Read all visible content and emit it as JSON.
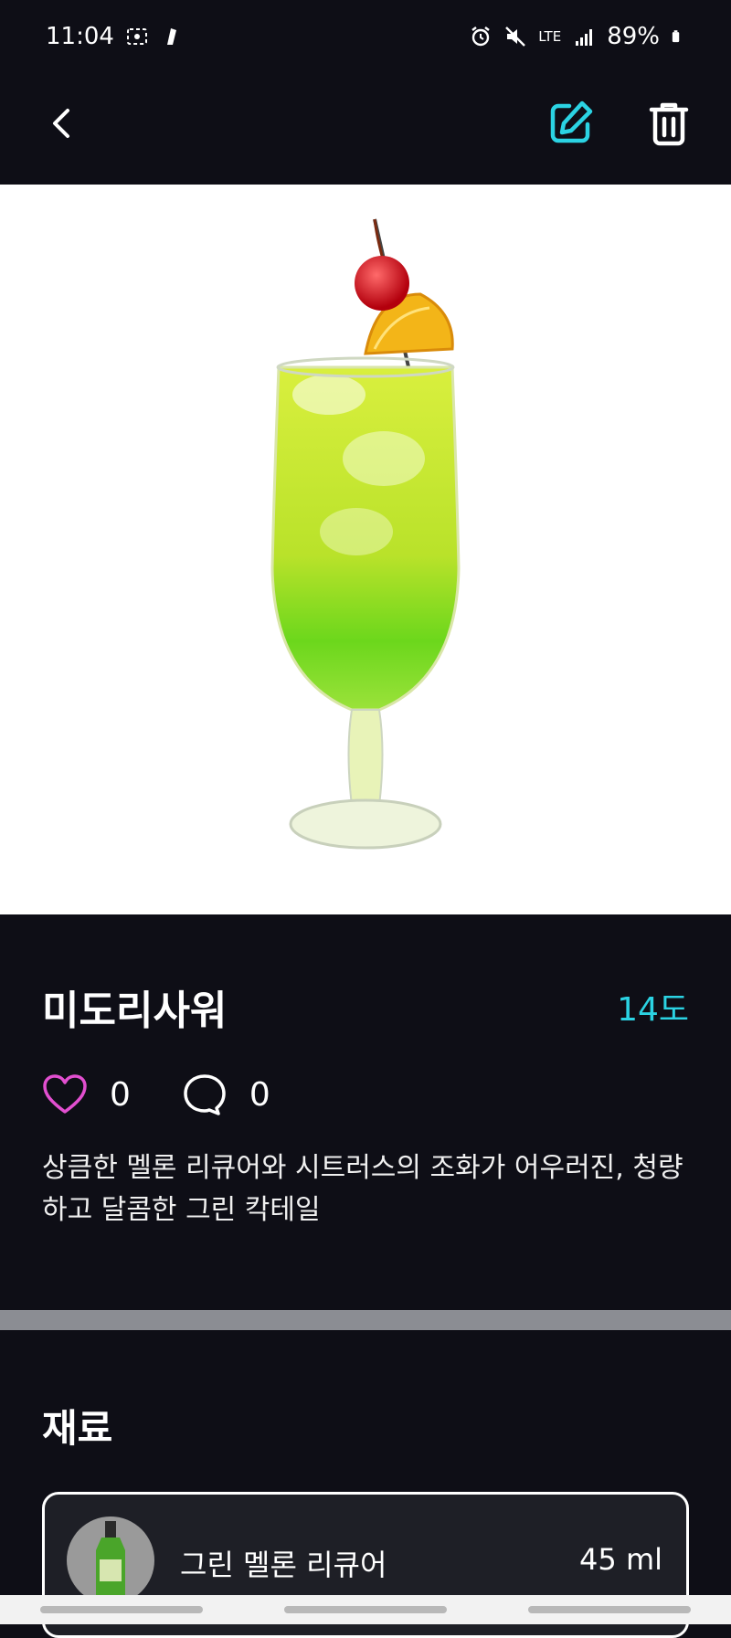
{
  "status_bar": {
    "time": "11:04",
    "network": "LTE",
    "battery": "89%",
    "icons": [
      "screen-record-icon",
      "gallery-icon",
      "alarm-icon",
      "mute-icon",
      "lte-icon",
      "signal-icon",
      "battery-icon"
    ]
  },
  "toolbar": {
    "back_icon": "chevron-left-icon",
    "edit_icon": "edit-icon",
    "delete_icon": "trash-icon",
    "accent_color": "#2bd3e3"
  },
  "cocktail": {
    "name": "미도리사워",
    "abv": "14도",
    "likes": "0",
    "comments": "0",
    "description": "상큼한 멜론 리큐어와 시트러스의 조화가 어우러진, 청량하고 달콤한 그린 칵테일"
  },
  "ingredients": {
    "title": "재료",
    "items": [
      {
        "name": "그린 멜론 리큐어",
        "amount": "45 ml"
      }
    ]
  },
  "colors": {
    "background": "#0e0e16",
    "like_pink": "#e24fd0",
    "divider": "#8b8d93"
  }
}
